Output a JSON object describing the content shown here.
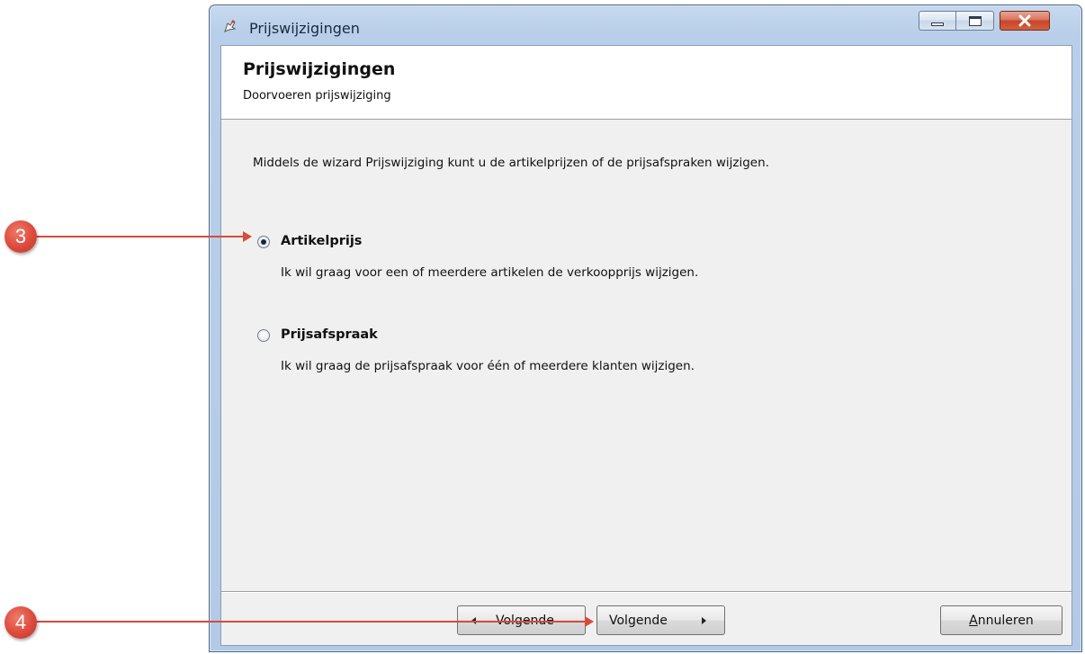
{
  "window": {
    "title": "Prijswijzigingen",
    "icon": "app-icon"
  },
  "wizard": {
    "title": "Prijswijzigingen",
    "subtitle": "Doorvoeren prijswijziging",
    "intro": "Middels de wizard Prijswijziging kunt u de artikelprijzen of de prijsafspraken wijzigen.",
    "options": [
      {
        "label": "Artikelprijs",
        "description": "Ik wil graag voor een of meerdere artikelen de verkoopprijs wijzigen.",
        "selected": true
      },
      {
        "label": "Prijsafspraak",
        "description": "Ik wil graag de prijsafspraak voor één of meerdere klanten wijzigen.",
        "selected": false
      }
    ]
  },
  "footer": {
    "back_label": "Volgende",
    "next_label": "Volgende",
    "cancel_label": "Annuleren"
  },
  "annotations": {
    "callout_3": "3",
    "callout_4": "4",
    "color": "#d84a3d"
  }
}
